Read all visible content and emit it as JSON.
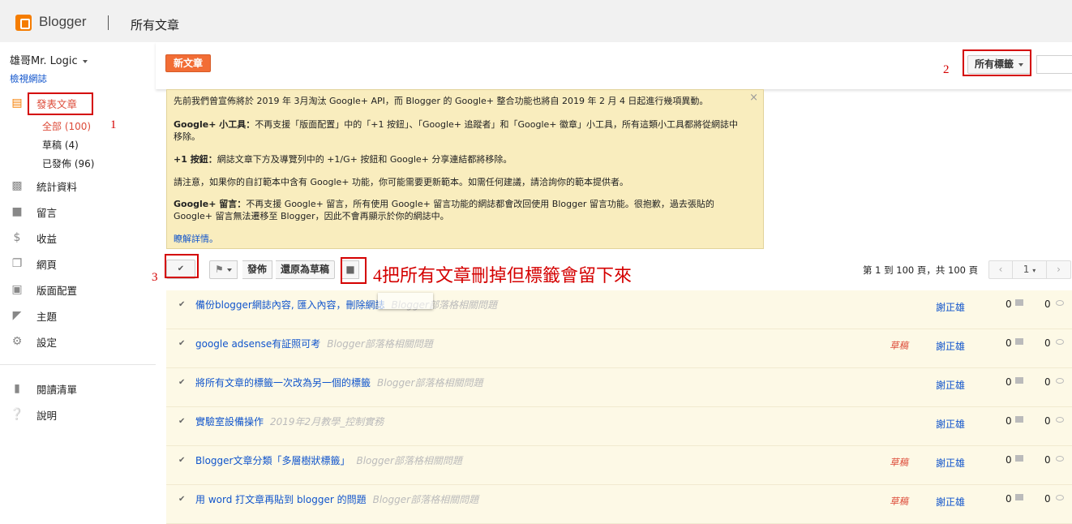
{
  "header": {
    "brand": "Blogger",
    "page_title": "所有文章"
  },
  "sidebar": {
    "blog_name": "雄哥Mr. Logic",
    "view_blog": "檢視網誌",
    "nav": [
      {
        "label": "發表文章",
        "icon": "posts-icon"
      },
      {
        "label": "統計資料",
        "icon": "stats-icon"
      },
      {
        "label": "留言",
        "icon": "comments-icon"
      },
      {
        "label": "收益",
        "icon": "dollar-icon"
      },
      {
        "label": "網頁",
        "icon": "pages-icon"
      },
      {
        "label": "版面配置",
        "icon": "layout-icon"
      },
      {
        "label": "主題",
        "icon": "theme-icon"
      },
      {
        "label": "設定",
        "icon": "gear-icon"
      }
    ],
    "sub": [
      {
        "label": "全部 (100)"
      },
      {
        "label": "草稿 (4)"
      },
      {
        "label": "已發佈 (96)"
      }
    ],
    "bottom": [
      {
        "label": "閱讀清單",
        "icon": "bookmark-icon"
      },
      {
        "label": "說明",
        "icon": "help-icon"
      }
    ]
  },
  "annotations": {
    "a1": "1",
    "a2": "2",
    "a3": "3",
    "a4": "4把所有文章刪掉但標籤會留下來"
  },
  "main": {
    "new_post": "新文章",
    "all_labels": "所有標籤",
    "notice": {
      "p1": "先前我們曾宣佈將於 2019 年 3月淘汰 Google+ API，而 Blogger 的 Google+ 整合功能也將自 2019 年 2 月 4 日起進行幾項異動。",
      "p2_bold": "Google+ 小工具：",
      "p2": "不再支援「版面配置」中的「+1 按鈕」、「Google+ 追蹤者」和「Google+ 徽章」小工具，所有這類小工具都將從網誌中移除。",
      "p3_bold": "+1 按鈕：",
      "p3": "網誌文章下方及導覽列中的 +1/G+ 按鈕和 Google+ 分享連結都將移除。",
      "p4": "請注意，如果你的自訂範本中含有 Google+ 功能，你可能需要更新範本。如需任何建議，請洽詢你的範本提供者。",
      "p5_bold": "Google+ 留言：",
      "p5": "不再支援 Google+ 留言，所有使用 Google+ 留言功能的網誌都會改回使用 Blogger 留言功能。很抱歉，過去張貼的 Google+ 留言無法遷移至 Blogger，因此不會再顯示於你的網誌中。",
      "more": "瞭解詳情。",
      "close": "×"
    },
    "toolbar": {
      "publish": "發佈",
      "revert": "還原為草稿",
      "page_info": "第 1 到 100 頁，共 100 頁",
      "page_num": "1"
    },
    "posts": [
      {
        "title": "備份blogger網誌內容, 匯入內容，刪除網誌",
        "label": "Blogger部落格相關問題",
        "draft": "",
        "author": "謝正雄",
        "comments": "0",
        "views": "0"
      },
      {
        "title": "google adsense有証照可考",
        "label": "Blogger部落格相關問題",
        "draft": "草稿",
        "author": "謝正雄",
        "comments": "0",
        "views": "0"
      },
      {
        "title": "將所有文章的標籤一次改為另一個的標籤",
        "label": "Blogger部落格相關問題",
        "draft": "",
        "author": "謝正雄",
        "comments": "0",
        "views": "0"
      },
      {
        "title": "實驗室設備操作",
        "label": "2019年2月教學_控制實務",
        "draft": "",
        "author": "謝正雄",
        "comments": "0",
        "views": "0"
      },
      {
        "title": "Blogger文章分類「多層樹狀標籤」",
        "label": "Blogger部落格相關問題",
        "draft": "草稿",
        "author": "謝正雄",
        "comments": "0",
        "views": "0"
      },
      {
        "title": "用 word 打文章再貼到 blogger 的問題",
        "label": "Blogger部落格相關問題",
        "draft": "草稿",
        "author": "謝正雄",
        "comments": "0",
        "views": "0"
      }
    ]
  }
}
